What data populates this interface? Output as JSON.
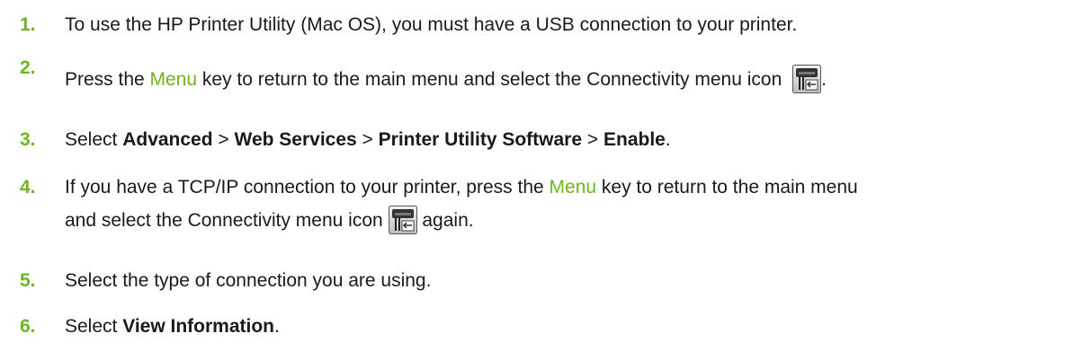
{
  "steps": [
    {
      "num": "1.",
      "text": "To use the HP Printer Utility (Mac OS), you must have a USB connection to your printer."
    },
    {
      "num": "2.",
      "pre": "Press the ",
      "menu": "Menu",
      "post": " key to return to the main menu and select the Connectivity menu icon",
      "end": "."
    },
    {
      "num": "3.",
      "pre": "Select ",
      "b1": "Advanced",
      "sep1": " > ",
      "b2": "Web Services",
      "sep2": " > ",
      "b3": "Printer Utility Software",
      "sep3": " > ",
      "b4": "Enable",
      "end": "."
    },
    {
      "num": "4.",
      "pre": "If you have a TCP/IP connection to your printer, press the ",
      "menu": "Menu",
      "post": " key to return to the main menu",
      "line2pre": "and select the Connectivity menu icon ",
      "line2post": " again."
    },
    {
      "num": "5.",
      "text": "Select the type of connection you are using."
    },
    {
      "num": "6.",
      "pre": "Select ",
      "b1": "View Information",
      "end": "."
    }
  ],
  "icons": {
    "connectivity": "connectivity-menu-icon"
  },
  "colors": {
    "accent": "#6fb51f",
    "text": "#1a1a1a"
  }
}
